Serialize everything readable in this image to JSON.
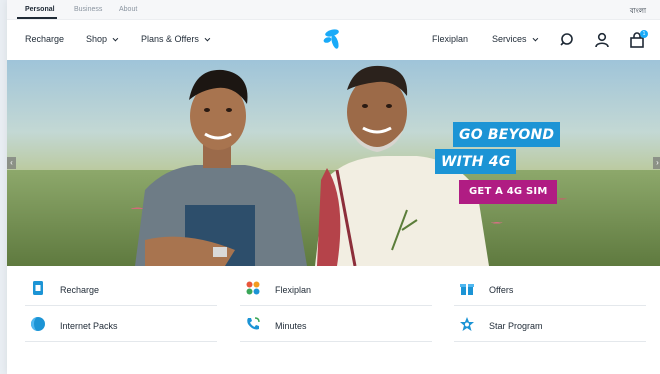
{
  "topbar": {
    "tabs": [
      "Personal",
      "Business",
      "About"
    ],
    "active_tab": "Personal",
    "language": "বাংলা"
  },
  "nav": {
    "left": [
      "Recharge",
      "Shop",
      "Plans & Offers"
    ],
    "right": [
      "Flexiplan",
      "Services"
    ],
    "cart_count": "1"
  },
  "hero": {
    "line1": "GO BEYOND",
    "line2": "WITH 4G",
    "cta": "GET A 4G SIM",
    "prev_icon": "chevron-left-icon",
    "next_icon": "chevron-right-icon"
  },
  "quick_links": [
    {
      "label": "Recharge",
      "icon": "recharge-card-icon"
    },
    {
      "label": "Flexiplan",
      "icon": "flexiplan-dots-icon"
    },
    {
      "label": "Offers",
      "icon": "gift-icon"
    },
    {
      "label": "Internet Packs",
      "icon": "globe-icon"
    },
    {
      "label": "Minutes",
      "icon": "phone-icon"
    },
    {
      "label": "Star Program",
      "icon": "star-icon"
    }
  ],
  "colors": {
    "brand_blue": "#19aaf8",
    "promo_blue": "#1c94d5",
    "cta_magenta": "#b01c83",
    "text_dark": "#1f2a36"
  }
}
